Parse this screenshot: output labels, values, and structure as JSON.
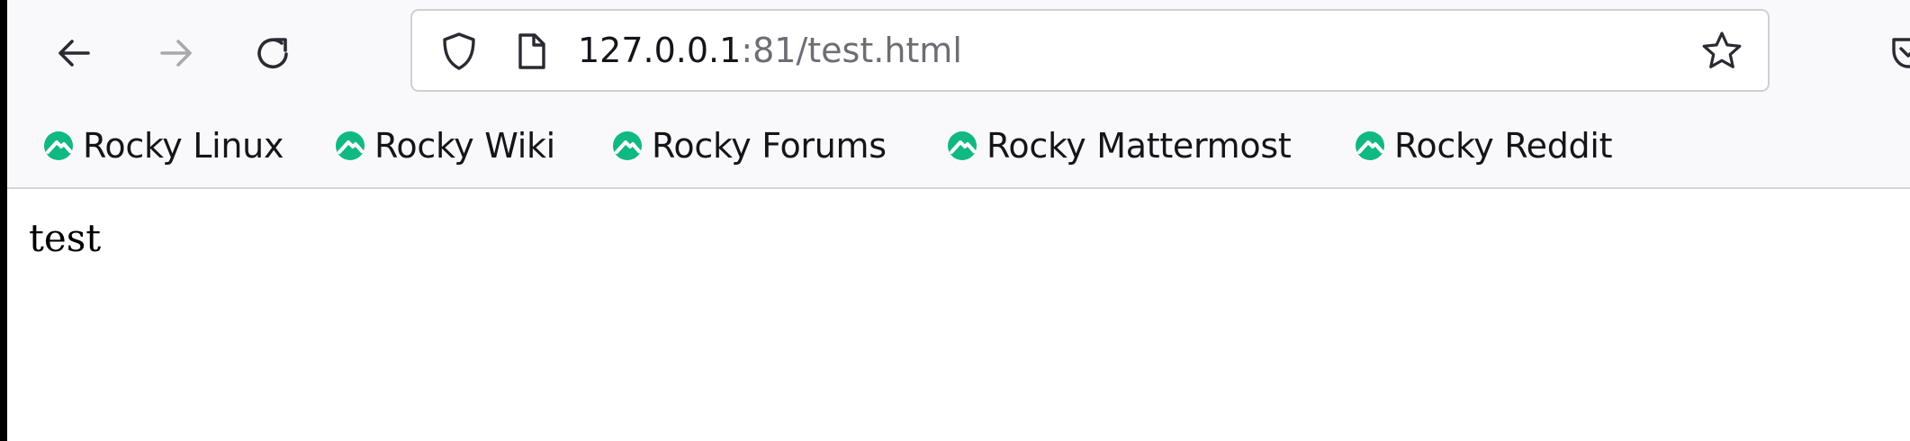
{
  "toolbar": {
    "back_icon": "arrow-left-icon",
    "forward_icon": "arrow-right-icon",
    "reload_icon": "reload-icon"
  },
  "urlbar": {
    "host": "127.0.0.1",
    "rest": ":81/test.html",
    "shield_icon": "shield-icon",
    "page_icon": "page-icon",
    "bookmark_star_icon": "star-icon"
  },
  "bookmarks": [
    {
      "label": "Rocky Linux",
      "icon": "rocky-logo-icon"
    },
    {
      "label": "Rocky Wiki",
      "icon": "rocky-logo-icon"
    },
    {
      "label": "Rocky Forums",
      "icon": "rocky-logo-icon"
    },
    {
      "label": "Rocky Mattermost",
      "icon": "rocky-logo-icon"
    },
    {
      "label": "Rocky Reddit",
      "icon": "rocky-logo-icon"
    }
  ],
  "page": {
    "body_text": "test"
  },
  "colors": {
    "rocky_green": "#10b981",
    "toolbar_bg": "#f9f9fb",
    "url_rest": "#6e6d75"
  }
}
